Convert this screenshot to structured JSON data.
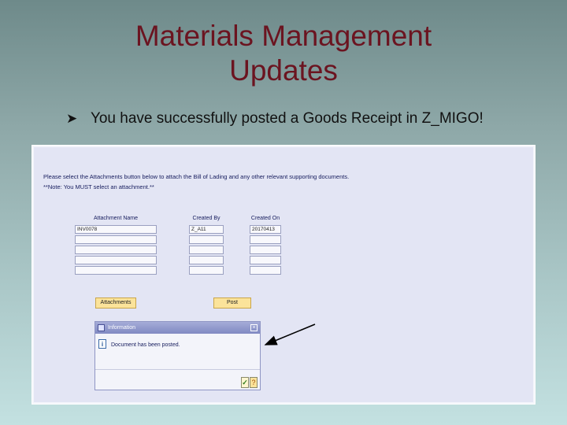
{
  "slide": {
    "title_line1": "Materials Management",
    "title_line2": "Updates",
    "bullet": "You have successfully posted a Goods Receipt in Z_MIGO!"
  },
  "screen": {
    "instruction": "Please select the Attachments button below to attach the Bill of Lading and any other relevant supporting documents.",
    "note": "**Note: You MUST select an attachment.**",
    "columns": [
      "Attachment Name",
      "Created By",
      "Created On"
    ],
    "rows": [
      [
        "INV0078",
        "Z_A11",
        "20170413"
      ],
      [
        "",
        "",
        ""
      ],
      [
        "",
        "",
        ""
      ],
      [
        "",
        "",
        ""
      ],
      [
        "",
        "",
        ""
      ]
    ],
    "attachments_button": "Attachments",
    "post_button": "Post"
  },
  "dialog": {
    "title": "Information",
    "message": "Document has been posted.",
    "ok_icon": "checkmark-icon",
    "help_icon": "help-icon"
  },
  "colors": {
    "title": "#6b1420",
    "screen_bg": "#e3e5f4",
    "button": "#fbe39a",
    "dialog_title_bar": "#8089c2"
  }
}
